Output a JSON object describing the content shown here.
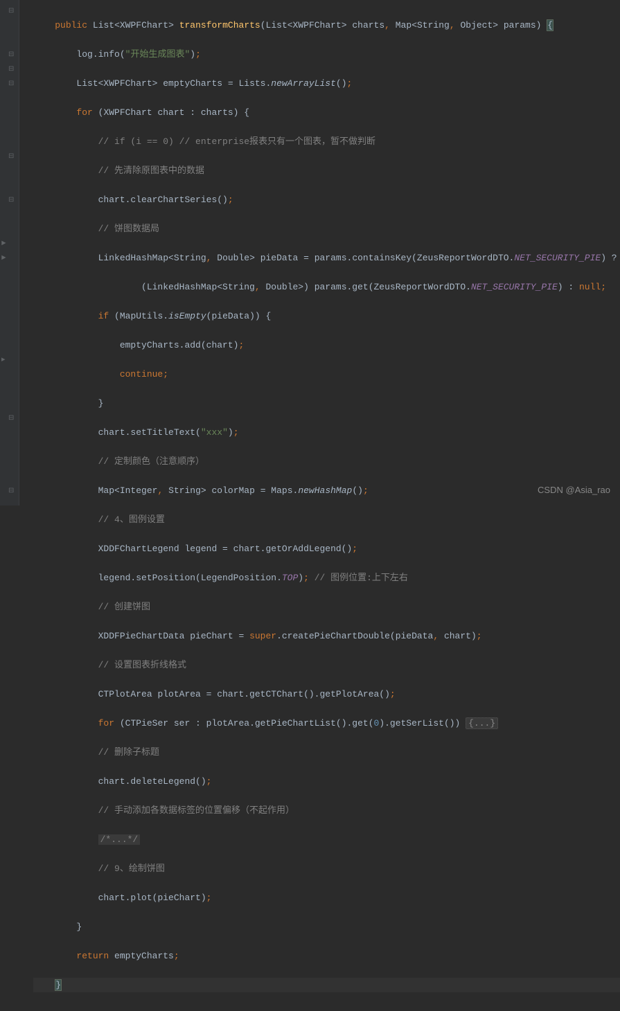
{
  "code": {
    "l1_public": "public",
    "l1_list": "List",
    "l1_xwpfchart": "XWPFChart",
    "l1_method": "transformCharts",
    "l1_params": "(List<XWPFChart> charts",
    "l1_map": "Map<String",
    "l1_object": "Object> params)",
    "l2_log": "log",
    "l2_info": ".info(",
    "l2_str": "\"开始生成图表\"",
    "l3_list": "List<XWPFChart> emptyCharts = Lists.",
    "l3_newarray": "newArrayList",
    "l4_for": "for",
    "l4_rest": "(XWPFChart chart : charts) {",
    "l5": "// if (i == 0) // enterprise报表只有一个图表，暂不做判断",
    "l6": "// 先清除原图表中的数据",
    "l7_a": "chart.clearChartSeries()",
    "l8": "// 饼图数据局",
    "l9_a": "LinkedHashMap<String",
    "l9_b": "Double> pieData = params.containsKey(ZeusReportWordDTO.",
    "l9_c": "NET_SECURITY_PIE",
    "l9_d": ") ?",
    "l10_a": "(LinkedHashMap<String",
    "l10_b": "Double>) params.get(ZeusReportWordDTO.",
    "l10_c": "NET_SECURITY_PIE",
    "l10_d": ") : ",
    "l10_null": "null",
    "l11_if": "if",
    "l11_a": "(MapUtils.",
    "l11_isempty": "isEmpty",
    "l11_b": "(pieData)) {",
    "l12_a": "emptyCharts.add(chart)",
    "l13_continue": "continue",
    "l15_a": "chart.setTitleText(",
    "l15_str": "\"xxx\"",
    "l16": "// 定制颜色（注意顺序）",
    "l17_a": "Map<Integer",
    "l17_b": "String> colorMap = Maps.",
    "l17_newhash": "newHashMap",
    "l18": "// 4、图例设置",
    "l19_a": "XDDFChartLegend legend = chart.getOrAddLegend()",
    "l20_a": "legend.setPosition(LegendPosition.",
    "l20_top": "TOP",
    "l20_b": "// 图例位置:上下左右",
    "l21": "// 创建饼图",
    "l22_a": "XDDFPieChartData pieChart = ",
    "l22_super": "super",
    "l22_b": ".createPieChartDouble(pieData",
    "l22_c": "chart)",
    "l23": "// 设置图表折线格式",
    "l24_a": "CTPlotArea plotArea = chart.getCTChart().getPlotArea()",
    "l25_for": "for",
    "l25_a": "(CTPieSer ser : plotArea.getPieChartList().get(",
    "l25_zero": "0",
    "l25_b": ").getSerList()) ",
    "l25_folded": "{...}",
    "l26": "// 删除子标题",
    "l27_a": "chart.deleteLegend()",
    "l28": "// 手动添加各数据标签的位置偏移（不起作用）",
    "l29_folded": "/*...*/",
    "l30": "// 9、绘制饼图",
    "l31_a": "chart.plot(pieChart)",
    "l33_return": "return",
    "l33_a": "emptyCharts"
  },
  "watermark": "CSDN @Asia_rao"
}
